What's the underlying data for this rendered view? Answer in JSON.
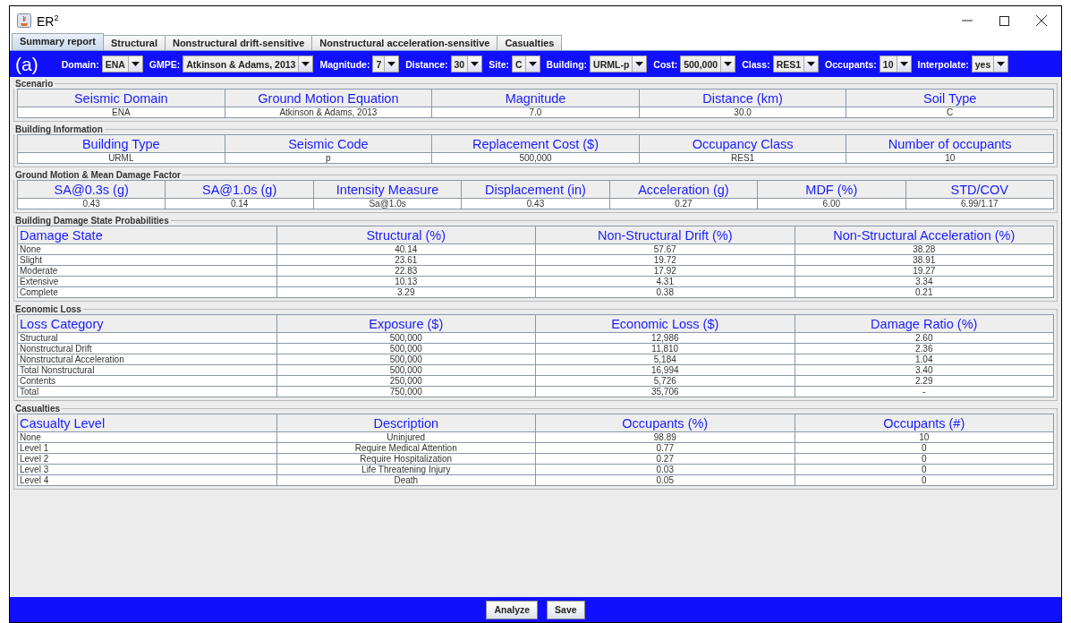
{
  "window": {
    "title": "ER$^{2}$"
  },
  "tabs": [
    {
      "label": "Summary report",
      "selected": true
    },
    {
      "label": "Structural",
      "selected": false
    },
    {
      "label": "Nonstructural drift-sensitive",
      "selected": false
    },
    {
      "label": "Nonstructural acceleration-sensitive",
      "selected": false
    },
    {
      "label": "Casualties",
      "selected": false
    }
  ],
  "toolbar": {
    "panel_label": "(a)",
    "selectors": [
      {
        "label": "Domain:",
        "value": "ENA"
      },
      {
        "label": "GMPE:",
        "value": "Atkinson & Adams, 2013"
      },
      {
        "label": "Magnitude:",
        "value": "7"
      },
      {
        "label": "Distance:",
        "value": "30"
      },
      {
        "label": "Site:",
        "value": "C"
      },
      {
        "label": "Building:",
        "value": "URML-p"
      },
      {
        "label": "Cost:",
        "value": "500,000"
      },
      {
        "label": "Class:",
        "value": "RES1"
      },
      {
        "label": "Occupants:",
        "value": "10"
      },
      {
        "label": "Interpolate:",
        "value": "yes"
      }
    ]
  },
  "sections": [
    {
      "title": "Scenario",
      "kind": "summary",
      "columns": [
        "Seismic Domain",
        "Ground Motion Equation",
        "Magnitude",
        "Distance (km)",
        "Soil Type"
      ],
      "rows": [
        [
          "ENA",
          "Atkinson & Adams, 2013",
          "7.0",
          "30.0",
          "C"
        ]
      ]
    },
    {
      "title": "Building Information",
      "kind": "summary",
      "columns": [
        "Building Type",
        "Seismic Code",
        "Replacement Cost ($)",
        "Occupancy Class",
        "Number of occupants"
      ],
      "rows": [
        [
          "URML",
          "p",
          "500,000",
          "RES1",
          "10"
        ]
      ]
    },
    {
      "title": "Ground Motion & Mean Damage Factor",
      "kind": "summary",
      "columns": [
        "SA@0.3s (g)",
        "SA@1.0s (g)",
        "Intensity Measure",
        "Displacement (in)",
        "Acceleration (g)",
        "MDF (%)",
        "STD/COV"
      ],
      "rows": [
        [
          "0.43",
          "0.14",
          "Sa@1.0s",
          "0.43",
          "0.27",
          "6.00",
          "6.99/1.17"
        ]
      ]
    },
    {
      "title": "Building Damage State Probabilities",
      "kind": "list",
      "columns": [
        "Damage State",
        "Structural (%)",
        "Non-Structural Drift (%)",
        "Non-Structural Acceleration (%)"
      ],
      "rows": [
        [
          "None",
          "40.14",
          "57.67",
          "38.28"
        ],
        [
          "Slight",
          "23.61",
          "19.72",
          "38.91"
        ],
        [
          "Moderate",
          "22.83",
          "17.92",
          "19.27"
        ],
        [
          "Extensive",
          "10.13",
          "4.31",
          "3.34"
        ],
        [
          "Complete",
          "3.29",
          "0.38",
          "0.21"
        ]
      ]
    },
    {
      "title": "Economic Loss",
      "kind": "list",
      "columns": [
        "Loss Category",
        "Exposure ($)",
        "Economic Loss ($)",
        "Damage Ratio (%)"
      ],
      "rows": [
        [
          "Structural",
          "500,000",
          "12,986",
          "2.60"
        ],
        [
          "Nonstructural Drift",
          "500,000",
          "11,810",
          "2.36"
        ],
        [
          "Nonstructural Acceleration",
          "500,000",
          "5,184",
          "1.04"
        ],
        [
          "Total Nonstructural",
          "500,000",
          "16,994",
          "3.40"
        ],
        [
          "Contents",
          "250,000",
          "5,726",
          "2.29"
        ],
        [
          "Total",
          "750,000",
          "35,706",
          "-"
        ]
      ]
    },
    {
      "title": "Casualties",
      "kind": "list",
      "columns": [
        "Casualty Level",
        "Description",
        "Occupants (%)",
        "Occupants (#)"
      ],
      "rows": [
        [
          "None",
          "Uninjured",
          "98.89",
          "10"
        ],
        [
          "Level 1",
          "Require Medical Attention",
          "0.77",
          "0"
        ],
        [
          "Level 2",
          "Require Hospitalization",
          "0.27",
          "0"
        ],
        [
          "Level 3",
          "Life Threatening Injury",
          "0.03",
          "0"
        ],
        [
          "Level 4",
          "Death",
          "0.05",
          "0"
        ]
      ]
    }
  ],
  "buttons": [
    "Analyze",
    "Save"
  ]
}
